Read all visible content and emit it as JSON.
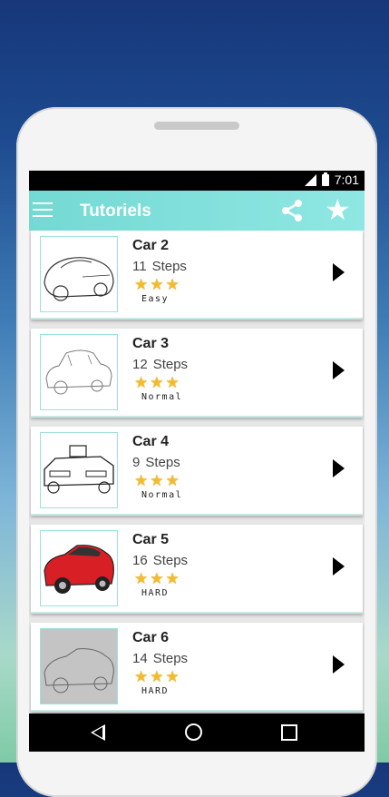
{
  "status": {
    "time": "7:01"
  },
  "toolbar": {
    "title": "Tutoriels",
    "share_icon": "share-icon",
    "star_icon": "star-icon"
  },
  "items": [
    {
      "title": "Car 2",
      "steps": "11",
      "steps_label": "Steps",
      "stars": "★★★",
      "level": "Easy"
    },
    {
      "title": "Car 3",
      "steps": "12",
      "steps_label": "Steps",
      "stars": "★★★",
      "level": "Normal"
    },
    {
      "title": "Car 4",
      "steps": "9",
      "steps_label": "Steps",
      "stars": "★★★",
      "level": "Normal"
    },
    {
      "title": "Car 5",
      "steps": "16",
      "steps_label": "Steps",
      "stars": "★★★",
      "level": "HARD"
    },
    {
      "title": "Car 6",
      "steps": "14",
      "steps_label": "Steps",
      "stars": "★★★",
      "level": "HARD"
    }
  ],
  "colors": {
    "toolbar": "#80e0dc",
    "star": "#f2bd2c",
    "car5": "#d91f26"
  }
}
